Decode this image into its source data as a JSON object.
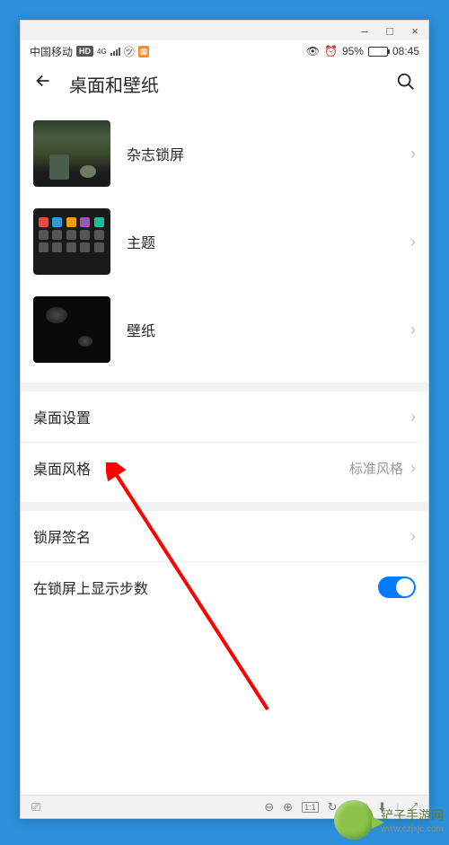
{
  "window": {
    "minimize": "–",
    "maximize": "□",
    "close": "×"
  },
  "status_bar": {
    "carrier": "中国移动",
    "hd": "HD",
    "network": "4G",
    "battery": "95%",
    "time": "08:45"
  },
  "header": {
    "title": "桌面和壁纸"
  },
  "items_with_image": [
    {
      "label": "杂志锁屏",
      "name": "magazine-lockscreen"
    },
    {
      "label": "主题",
      "name": "theme"
    },
    {
      "label": "壁纸",
      "name": "wallpaper"
    }
  ],
  "items_text": [
    {
      "label": "桌面设置",
      "value": "",
      "name": "desktop-settings",
      "chevron": true
    },
    {
      "label": "桌面风格",
      "value": "标准风格",
      "name": "desktop-style",
      "chevron": true
    }
  ],
  "items_text2": [
    {
      "label": "锁屏签名",
      "value": "",
      "name": "lockscreen-signature",
      "type": "nav"
    },
    {
      "label": "在锁屏上显示步数",
      "value": "",
      "name": "show-steps",
      "type": "toggle"
    }
  ],
  "toolbar": {
    "scale": "1:1"
  },
  "watermark": {
    "text": "铲子手游网",
    "url": "www.czjxjc.com"
  }
}
